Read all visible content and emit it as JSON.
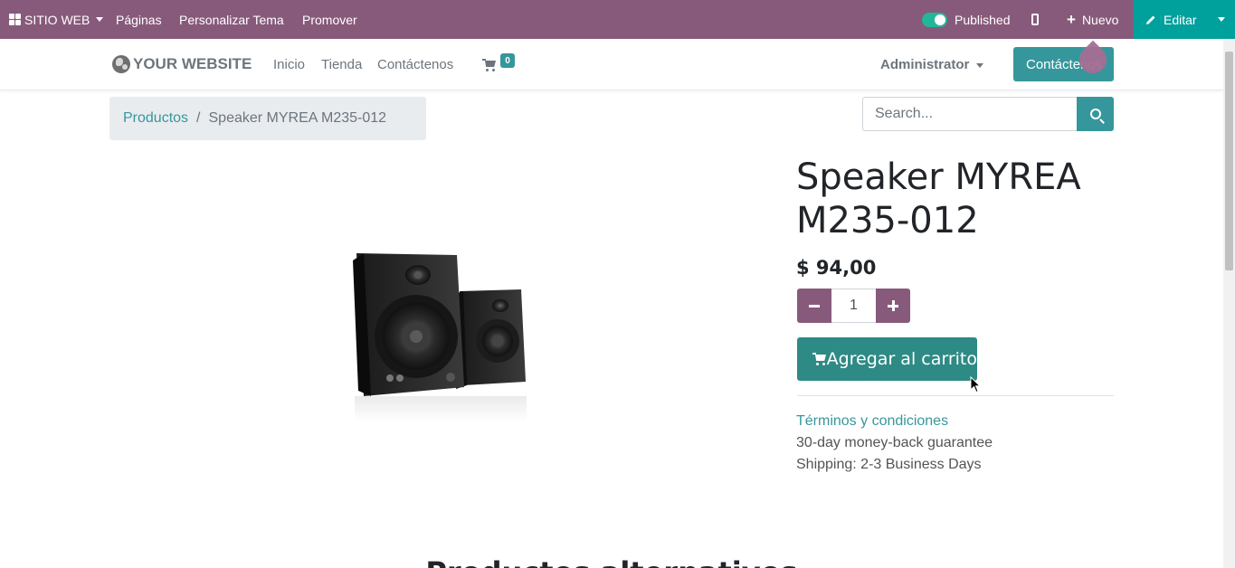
{
  "admin_bar": {
    "app_menu": "SITIO WEB",
    "pages": "Páginas",
    "customize_theme": "Personalizar Tema",
    "promote": "Promover",
    "published": "Published",
    "new": "Nuevo",
    "edit": "Editar",
    "colors": {
      "bar": "#875a7b",
      "edit": "#00a09d",
      "toggle_on": "#21b799"
    }
  },
  "header": {
    "logo": "YOUR WEBSITE",
    "nav": [
      "Inicio",
      "Tienda",
      "Contáctenos"
    ],
    "cart_count": "0",
    "user_menu": "Administrator",
    "contact_button": "Contáctenos"
  },
  "breadcrumb": {
    "parent": "Productos",
    "separator": "/",
    "current": "Speaker MYREA M235-012"
  },
  "search": {
    "placeholder": "Search..."
  },
  "product": {
    "title": "Speaker MYREA M235-012",
    "price": "$ 94,00",
    "quantity": "1",
    "add_to_cart": "Agregar al carrito",
    "terms_link": "Términos y condiciones",
    "guarantee": "30-day money-back guarantee",
    "shipping": "Shipping: 2-3 Business Days"
  },
  "alternative_heading": "Productos alternativos",
  "icons": {
    "app_grid": "grid-icon",
    "globe": "globe-icon",
    "cart": "cart-icon",
    "mobile": "mobile-icon",
    "pencil": "pencil-icon",
    "search": "search-icon"
  },
  "theme": {
    "primary": "#35979c",
    "secondary": "#875a7b",
    "add_to_cart": "#2e8a85"
  }
}
